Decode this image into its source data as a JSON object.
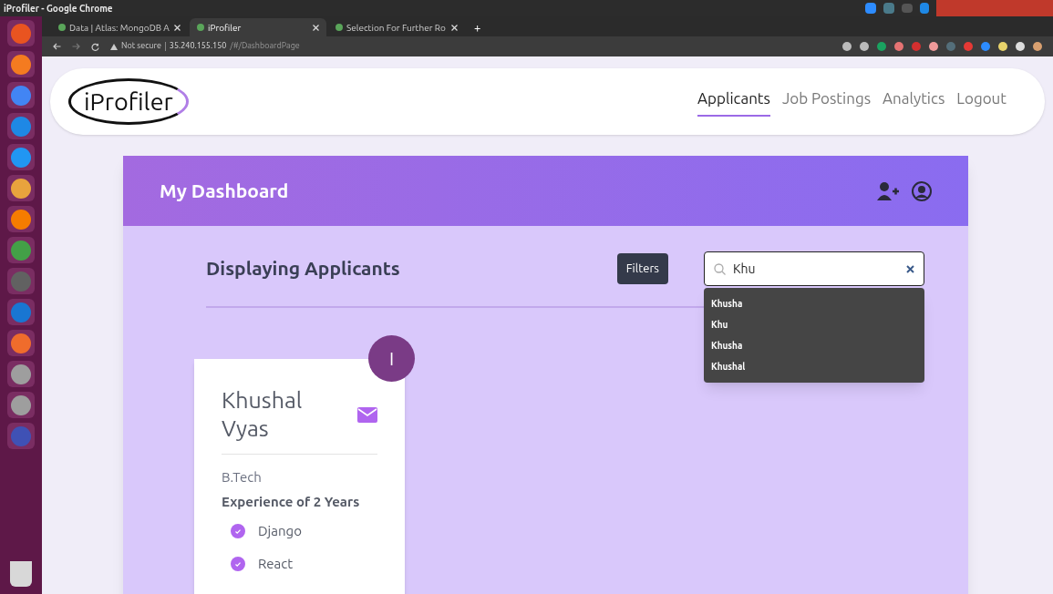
{
  "window": {
    "title": "iProfiler - Google Chrome"
  },
  "browser_tabs": [
    {
      "label": "Data | Atlas: MongoDB A",
      "selected": false
    },
    {
      "label": "iProfiler",
      "selected": true
    },
    {
      "label": "Selection For Further Ro",
      "selected": false
    }
  ],
  "new_tab": "+",
  "address_bar": {
    "security": "Not secure",
    "host": "35.240.155.150",
    "path": "/#/DashboardPage"
  },
  "navbar": {
    "logo": "iProfiler",
    "links": [
      {
        "label": "Applicants",
        "selected": true
      },
      {
        "label": "Job Postings",
        "selected": false
      },
      {
        "label": "Analytics",
        "selected": false
      },
      {
        "label": "Logout",
        "selected": false
      }
    ]
  },
  "dashboard": {
    "title": "My Dashboard"
  },
  "heading": "Displaying Applicants",
  "filters_button": "Filters",
  "search": {
    "value": "Khu",
    "suggestions": [
      "Khusha",
      "Khu",
      "Khusha",
      "Khushal"
    ]
  },
  "applicants": [
    {
      "initial": "I",
      "name": "Khushal Vyas",
      "degree": "B.Tech",
      "experience": "Experience of 2 Years",
      "skills": [
        "Django",
        "React"
      ]
    }
  ]
}
